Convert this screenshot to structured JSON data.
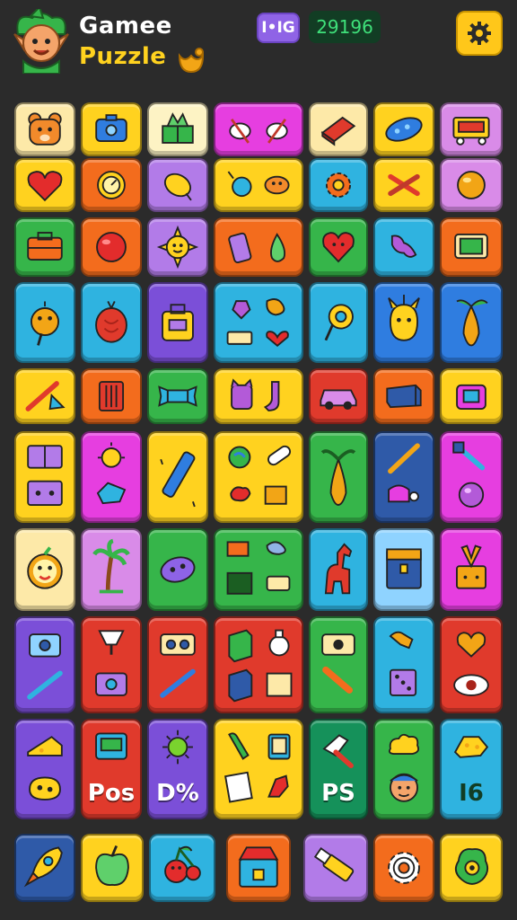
{
  "header": {
    "title_line1": "Gamee",
    "title_line2": "Puzzle",
    "level_badge": "I•IG",
    "score": "29196",
    "icons": [
      "elf-avatar-icon",
      "gold-coin-icon",
      "settings-gear-icon"
    ]
  },
  "board": {
    "tile_labels": {
      "pos": "Pos",
      "dpct": "D%",
      "ps": "PS",
      "ig": "I6"
    },
    "tile_items": [
      "bear-face",
      "camera",
      "gift-box",
      "dart-pair",
      "red-eraser",
      "blue-bean",
      "game-console",
      "heart",
      "gear-clock",
      "lemon",
      "balloon-fish",
      "orange-gear",
      "crossed-bones",
      "orange-ball",
      "suitcase",
      "red-ball",
      "smiling-sun",
      "phone-pear",
      "red-heart-face",
      "pink-bone",
      "tv-screen",
      "orange-bird",
      "red-seed",
      "purple-bag",
      "mixed-items",
      "green-hook",
      "yellow-creature",
      "pear",
      "crayon-pair",
      "red-box",
      "blue-wrapper",
      "cat-sock",
      "pink-car",
      "blue-crate",
      "pink-camera",
      "drawers",
      "sun-bubble",
      "flashlight",
      "globe-pill",
      "pear-tree",
      "pencil-toy",
      "hammer-orb",
      "lemon-face",
      "palm-tree",
      "blue-stone",
      "frames",
      "red-horse",
      "blue-chest",
      "flower-box",
      "camera-pen",
      "lamp-camera",
      "radio-pen",
      "box-trophy",
      "camera-stick",
      "dog-dice",
      "heart-eye",
      "cheese",
      "console-pos",
      "sun-d",
      "knife-card",
      "brush-ps",
      "cloud-face",
      "cake-ig"
    ],
    "bottom_items": [
      "rocket",
      "green-apple",
      "red-cherries",
      "toy-chest",
      "glue-stick",
      "white-gear",
      "green-bug"
    ]
  },
  "colors": {
    "background": "#2b2b2b",
    "accent_yellow": "#ffc71a",
    "score_green": "#3fe07a",
    "badge_purple": "#8f63e6"
  }
}
